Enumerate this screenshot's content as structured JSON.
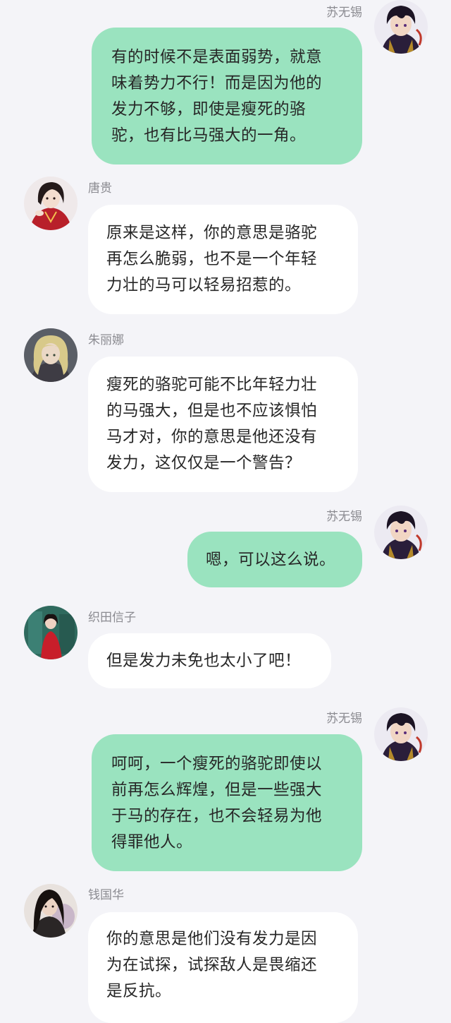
{
  "messages": [
    {
      "side": "right",
      "sender": "苏无锡",
      "avatar": "dark-hair-anime-avatar-icon",
      "text": "有的时候不是表面弱势，就意\n味着势力不行！而是因为他的\n发力不够，即使是瘦死的骆\n驼，也有比马强大的一角。"
    },
    {
      "side": "left",
      "sender": "唐贵",
      "avatar": "red-robe-avatar-icon",
      "text": "原来是这样，你的意思是骆驼\n再怎么脆弱，也不是一个年轻\n力壮的马可以轻易招惹的。"
    },
    {
      "side": "left",
      "sender": "朱丽娜",
      "avatar": "blonde-woman-avatar-icon",
      "text": "瘦死的骆驼可能不比年轻力壮\n的马强大，但是也不应该惧怕\n马才对，你的意思是他还没有\n发力，这仅仅是一个警告？"
    },
    {
      "side": "right",
      "sender": "苏无锡",
      "avatar": "dark-hair-anime-avatar-icon",
      "text": "嗯，可以这么说。"
    },
    {
      "side": "left",
      "sender": "织田信子",
      "avatar": "red-dress-avatar-icon",
      "text": "但是发力未免也太小了吧！"
    },
    {
      "side": "right",
      "sender": "苏无锡",
      "avatar": "dark-hair-anime-avatar-icon",
      "text": "呵呵，一个瘦死的骆驼即使以\n前再怎么辉煌，但是一些强大\n于马的存在，也不会轻易为他\n得罪他人。"
    },
    {
      "side": "left",
      "sender": "钱国华",
      "avatar": "long-hair-man-avatar-icon",
      "text": "你的意思是他们没有发力是因\n为在试探，试探敌人是畏缩还\n是反抗。"
    }
  ],
  "colors": {
    "background": "#f4f4f8",
    "own_bubble": "#9ae3bf",
    "other_bubble": "#ffffff",
    "name_text": "#8b8b91",
    "message_text": "#262626"
  }
}
